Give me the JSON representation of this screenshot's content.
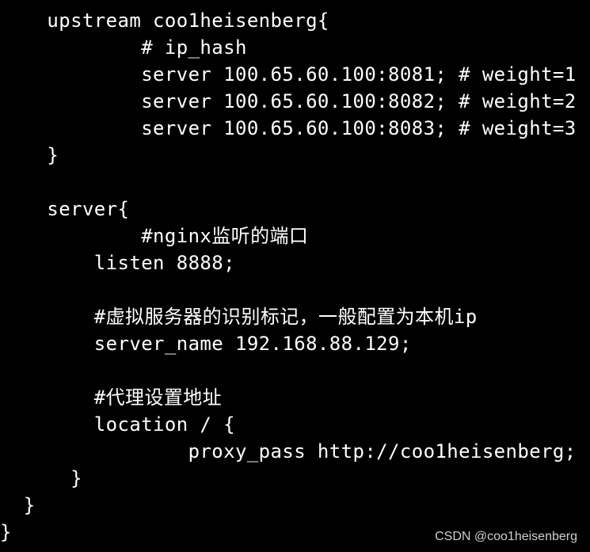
{
  "code": {
    "lines": [
      "    upstream coo1heisenberg{",
      "            # ip_hash",
      "            server 100.65.60.100:8081; # weight=1",
      "            server 100.65.60.100:8082; # weight=2",
      "            server 100.65.60.100:8083; # weight=3",
      "    }",
      "",
      "    server{",
      "            #nginx监听的端口",
      "        listen 8888;",
      "",
      "        #虚拟服务器的识别标记，一般配置为本机ip",
      "        server_name 192.168.88.129;",
      "",
      "        #代理设置地址",
      "        location / {",
      "                proxy_pass http://coo1heisenberg;",
      "      }",
      "  }",
      "}"
    ]
  },
  "watermark": {
    "text": "CSDN @coo1heisenberg"
  },
  "colors": {
    "background": "#000000",
    "text": "#ffffff",
    "watermark": "#cfcfcf"
  }
}
